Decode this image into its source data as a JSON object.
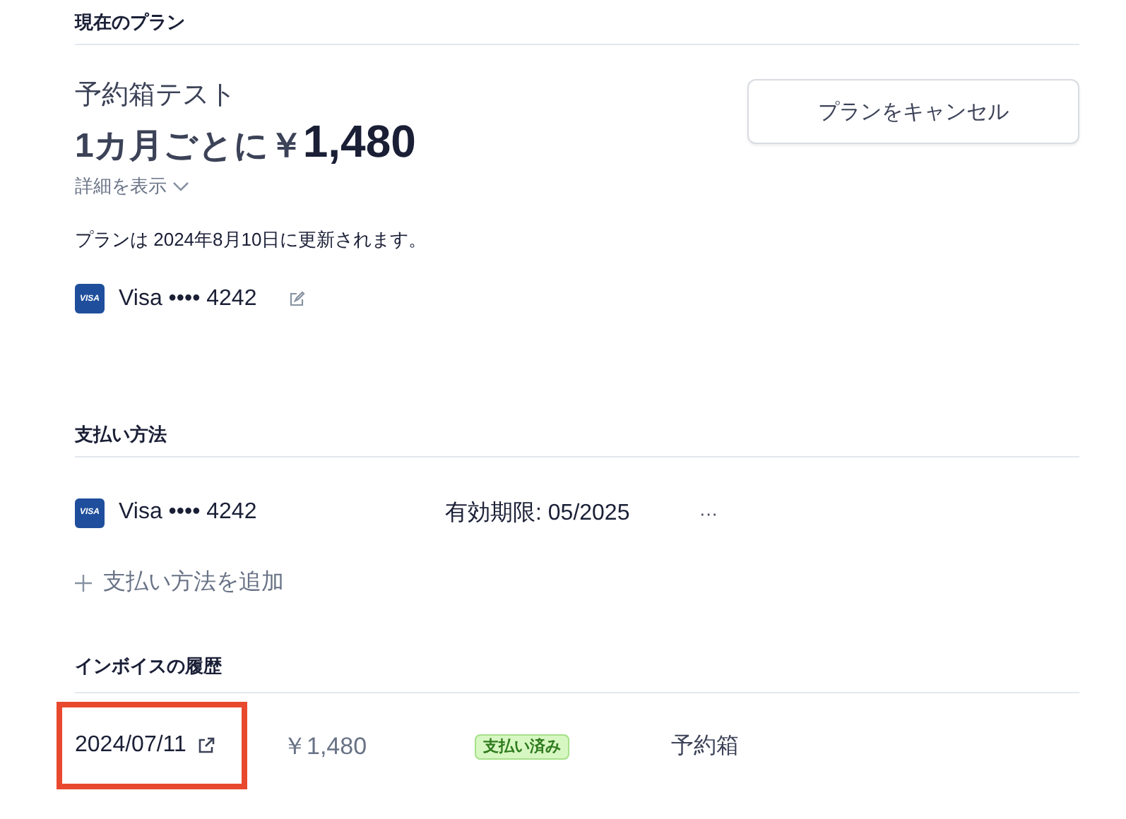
{
  "current_plan": {
    "heading": "現在のプラン",
    "name": "予約箱テスト",
    "price_prefix": "1カ月ごとに￥",
    "price": "1,480",
    "details_toggle": "詳細を表示",
    "expanded": false,
    "renewal_note": "プランは 2024年8月10日に更新されます。",
    "card": {
      "brand": "VISA",
      "label": "Visa •••• 4242"
    },
    "cancel_button": "プランをキャンセル"
  },
  "payment_methods": {
    "heading": "支払い方法",
    "methods": [
      {
        "brand": "VISA",
        "label": "Visa •••• 4242",
        "expiry": "有効期限: 05/2025",
        "menu": "···"
      }
    ],
    "add_link": "支払い方法を追加"
  },
  "invoice_history": {
    "heading": "インボイスの履歴",
    "invoices": [
      {
        "date": "2024/07/11",
        "amount": "￥1,480",
        "status": "支払い済み",
        "product": "予約箱",
        "highlighted": true
      }
    ]
  }
}
